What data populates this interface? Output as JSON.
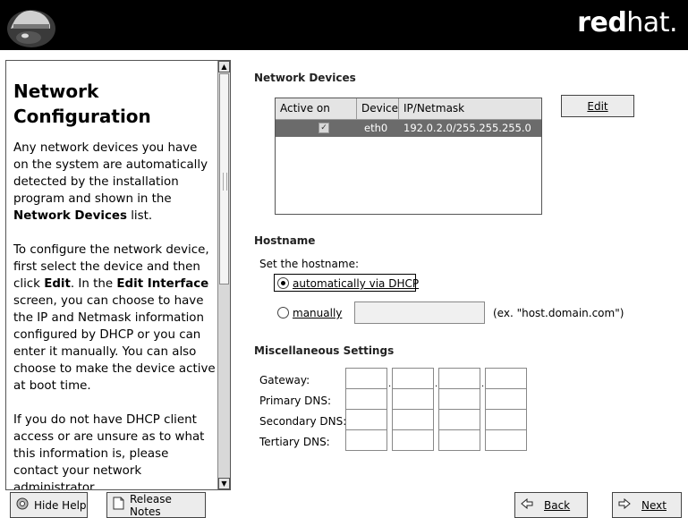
{
  "header": {
    "brand_bold": "red",
    "brand_light": "hat."
  },
  "help": {
    "title": "Network Configuration",
    "paragraphs": [
      [
        "Any network devices you have on the system are automatically detected by the installation program and shown in the ",
        "Network Devices",
        " list."
      ],
      [
        "To configure the network device, first select the device and then click ",
        "Edit",
        ". In the ",
        "Edit Interface",
        " screen, you can choose to have the IP and Netmask information configured by DHCP or you can enter it manually. You can also choose to make the device active at boot time."
      ],
      [
        "If you do not have DHCP client access or are unsure as to what this information is, please contact your network administrator."
      ]
    ]
  },
  "network_devices": {
    "section_title": "Network Devices",
    "columns": [
      "Active on Boot",
      "Device",
      "IP/Netmask"
    ],
    "rows": [
      {
        "active": true,
        "device": "eth0",
        "ip_netmask": "192.0.2.0/255.255.255.0"
      }
    ],
    "edit_button": "Edit"
  },
  "hostname": {
    "section_title": "Hostname",
    "prompt": "Set the hostname:",
    "option_auto": "automatically via DHCP",
    "option_manual": "manually",
    "manual_value": "",
    "example": "(ex. \"host.domain.com\")",
    "selected": "auto"
  },
  "misc": {
    "section_title": "Miscellaneous Settings",
    "fields": [
      {
        "label": "Gateway:"
      },
      {
        "label": "Primary DNS:"
      },
      {
        "label": "Secondary DNS:"
      },
      {
        "label": "Tertiary DNS:"
      }
    ]
  },
  "footer": {
    "hide_help": "Hide Help",
    "release_notes": "Release Notes",
    "back": "Back",
    "next": "Next"
  }
}
